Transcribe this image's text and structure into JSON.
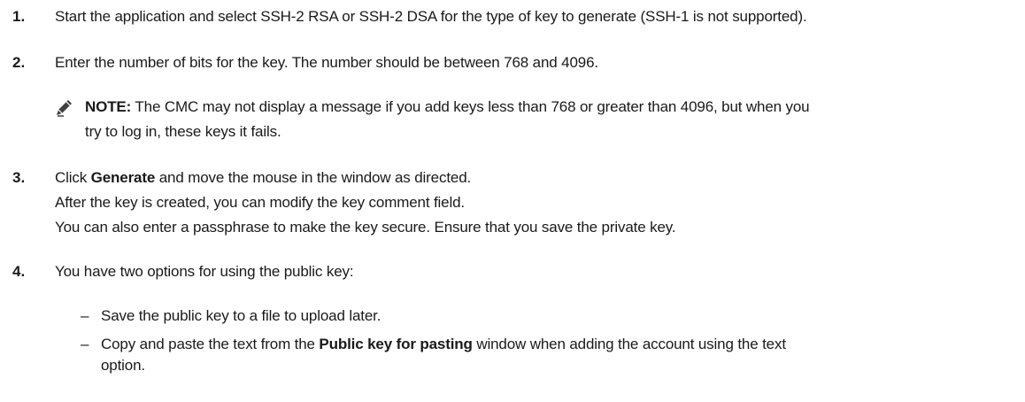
{
  "steps": [
    {
      "number": "1.",
      "text": "Start the application and select SSH-2 RSA or SSH-2 DSA for the type of key to generate (SSH-1 is not supported)."
    },
    {
      "number": "2.",
      "text": "Enter the number of bits for the key. The number should be between 768 and 4096.",
      "note": {
        "label": "NOTE:",
        "line1": " The CMC may not display a message if you add keys less than 768 or greater than 4096, but when you",
        "line2": "try to log in, these keys it fails."
      }
    },
    {
      "number": "3.",
      "pre": "Click ",
      "bold": "Generate",
      "post": " and move the mouse in the window as directed.",
      "para1": "After the key is created, you can modify the key comment field.",
      "para2": "You can also enter a passphrase to make the key secure. Ensure that you save the private key."
    },
    {
      "number": "4.",
      "text": "You have two options for using the public key:",
      "bullets": [
        {
          "dash": "–",
          "text": "Save the public key to a file to upload later."
        },
        {
          "dash": "–",
          "pre": "Copy and paste the text from the ",
          "bold": "Public key for pasting",
          "post": " window when adding the account using the text",
          "line2": "option."
        }
      ]
    }
  ],
  "icons": {
    "note": "pencil-note-icon"
  },
  "colors": {
    "text": "#1a1a1a",
    "icon": "#404040"
  }
}
